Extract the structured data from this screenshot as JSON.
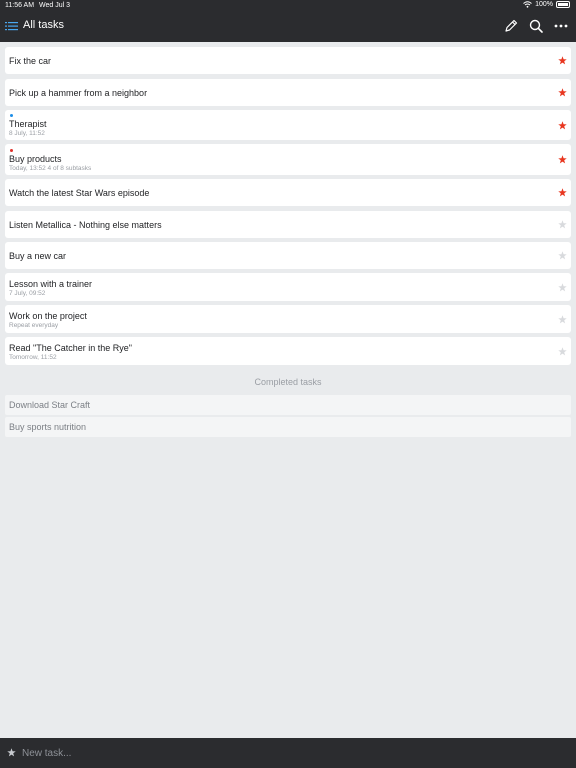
{
  "status_bar": {
    "time": "11:56 AM",
    "date": "Wed Jul 3",
    "battery": "100%"
  },
  "header": {
    "title": "All tasks",
    "icons": [
      "menu-list-icon",
      "pencil-icon",
      "search-icon",
      "more-icon"
    ]
  },
  "tasks": [
    {
      "name": "Fix the car",
      "starred": true
    },
    {
      "name": "Pick up a hammer from a neighbor",
      "starred": true
    },
    {
      "name": "Therapist",
      "sub": "8 July, 11:52",
      "starred": true,
      "dot": "#1e8ee8"
    },
    {
      "name": "Buy products",
      "sub": "Today, 13:52   4 of 8 subtasks",
      "starred": true,
      "dot": "#e0312b"
    },
    {
      "name": "Watch the latest Star Wars episode",
      "starred": true
    },
    {
      "name": "Listen Metallica - Nothing else matters",
      "starred": false
    },
    {
      "name": "Buy a new car",
      "starred": false
    },
    {
      "name": "Lesson with a trainer",
      "sub": "7 July, 09:52",
      "starred": false
    },
    {
      "name": "Work on the project",
      "sub": "Repeat everyday",
      "starred": false
    },
    {
      "name": "Read \"The Catcher in the Rye\"",
      "sub": "Tomorrow, 11:52",
      "starred": false
    }
  ],
  "completed": {
    "header": "Completed tasks",
    "items": [
      "Download Star Craft",
      "Buy sports nutrition"
    ]
  },
  "new_task": {
    "placeholder": "New task..."
  },
  "colors": {
    "star_active": "#e8361f",
    "star_inactive": "#d8dadd",
    "accent": "#1e8ee8",
    "bar": "#2b2c2f",
    "background": "#e9ebed"
  }
}
